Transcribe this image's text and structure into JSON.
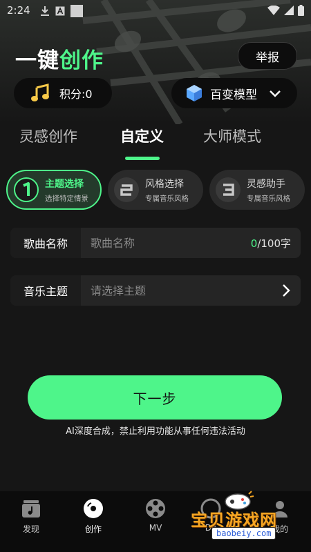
{
  "status_bar": {
    "time": "2:24"
  },
  "header": {
    "logo": {
      "part1": "一键",
      "part2": "创作"
    },
    "report_label": "举报",
    "points_label": "积分:0",
    "model_label": "百变模型"
  },
  "mode_tabs": [
    {
      "label": "灵感创作",
      "active": false
    },
    {
      "label": "自定义",
      "active": true
    },
    {
      "label": "大师模式",
      "active": false
    }
  ],
  "steps": [
    {
      "number": "1",
      "title": "主题选择",
      "subtitle": "选择特定情景",
      "active": true
    },
    {
      "number": "2",
      "title": "风格选择",
      "subtitle": "专属音乐风格",
      "active": false
    },
    {
      "number": "3",
      "title": "灵感助手",
      "subtitle": "专属音乐风格",
      "active": false
    }
  ],
  "form": {
    "song_name": {
      "label": "歌曲名称",
      "placeholder": "歌曲名称",
      "value": "",
      "count_current": "0",
      "count_rest": "/100字"
    },
    "music_theme": {
      "label": "音乐主题",
      "placeholder": "请选择主题"
    }
  },
  "next_button_label": "下一步",
  "disclaimer": "AI深度合成，禁止利用功能从事任何违法活动",
  "bottom_nav": [
    {
      "label": "发现",
      "icon": "music-folder-icon",
      "active": false
    },
    {
      "label": "创作",
      "icon": "disc-icon",
      "active": true
    },
    {
      "label": "MV",
      "icon": "film-reel-icon",
      "active": false
    },
    {
      "label": "De",
      "icon": "compass-icon",
      "active": false
    },
    {
      "label": "我的",
      "icon": "user-icon",
      "active": false
    }
  ],
  "watermark": {
    "title": "宝贝游戏网",
    "url": "baobeiy.com"
  },
  "colors": {
    "accent": "#4ef58a",
    "background": "#161616",
    "card": "#2a2a2a",
    "watermark": "#f5a623"
  }
}
